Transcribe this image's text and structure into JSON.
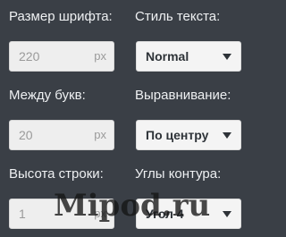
{
  "font_size": {
    "label": "Размер шрифта:",
    "value": "220",
    "unit": "px"
  },
  "text_style": {
    "label": "Стиль текста:",
    "selected": "Normal",
    "icon": "chevron-down-icon"
  },
  "letter_spacing": {
    "label": "Между букв:",
    "value": "20",
    "unit": "px"
  },
  "alignment": {
    "label": "Выравнивание:",
    "selected": "По центру",
    "icon": "chevron-down-icon"
  },
  "line_height": {
    "label": "Высота строки:",
    "value": "1",
    "unit": "px"
  },
  "outline_corners": {
    "label": "Углы контура:",
    "selected": "Угол 4",
    "icon": "chevron-down-icon"
  },
  "watermark": "Mipod.ru",
  "colors": {
    "background": "#3a3f46",
    "input_bg": "#eeeeee",
    "text": "#eef0f2"
  }
}
